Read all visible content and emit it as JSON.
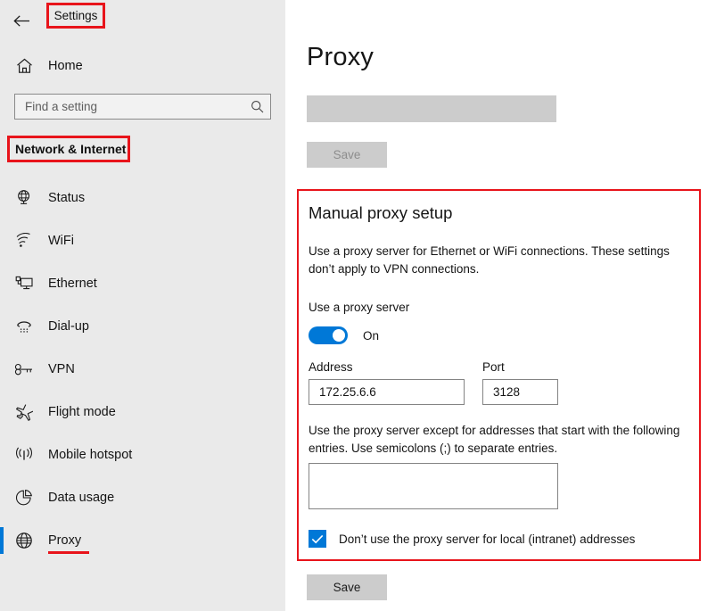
{
  "window": {
    "title": "Settings",
    "back_icon": "back-arrow-icon"
  },
  "sidebar": {
    "home": {
      "label": "Home",
      "icon": "home-icon"
    },
    "search": {
      "placeholder": "Find a setting",
      "value": "",
      "icon": "search-icon"
    },
    "category": "Network & Internet",
    "items": [
      {
        "label": "Status",
        "icon": "status-globe-icon",
        "selected": false,
        "annotated": false
      },
      {
        "label": "WiFi",
        "icon": "wifi-icon",
        "selected": false,
        "annotated": false
      },
      {
        "label": "Ethernet",
        "icon": "ethernet-icon",
        "selected": false,
        "annotated": false
      },
      {
        "label": "Dial-up",
        "icon": "dialup-phone-icon",
        "selected": false,
        "annotated": false
      },
      {
        "label": "VPN",
        "icon": "vpn-key-icon",
        "selected": false,
        "annotated": false
      },
      {
        "label": "Flight mode",
        "icon": "airplane-icon",
        "selected": false,
        "annotated": false
      },
      {
        "label": "Mobile hotspot",
        "icon": "hotspot-icon",
        "selected": false,
        "annotated": false
      },
      {
        "label": "Data usage",
        "icon": "pie-chart-icon",
        "selected": false,
        "annotated": false
      },
      {
        "label": "Proxy",
        "icon": "globe-icon",
        "selected": true,
        "annotated": true
      }
    ]
  },
  "main": {
    "page_title": "Proxy",
    "top_field_value": "",
    "top_save_label": "Save",
    "manual_panel": {
      "heading": "Manual proxy setup",
      "description": "Use a proxy server for Ethernet or WiFi connections. These settings don’t apply to VPN connections.",
      "use_proxy_label": "Use a proxy server",
      "toggle_state": "On",
      "address_label": "Address",
      "address_value": "172.25.6.6",
      "port_label": "Port",
      "port_value": "3128",
      "exceptions_description": "Use the proxy server except for addresses that start with the following entries. Use semicolons (;) to separate entries.",
      "exceptions_value": "",
      "local_bypass_label": "Don’t use the proxy server for local (intranet) addresses",
      "local_bypass_checked": true
    },
    "bottom_save_label": "Save"
  },
  "colors": {
    "accent_blue": "#0078d7",
    "annotation_red": "#e8141b",
    "sidebar_background": "#eaeaea",
    "disabled_gray": "#cccccc"
  }
}
